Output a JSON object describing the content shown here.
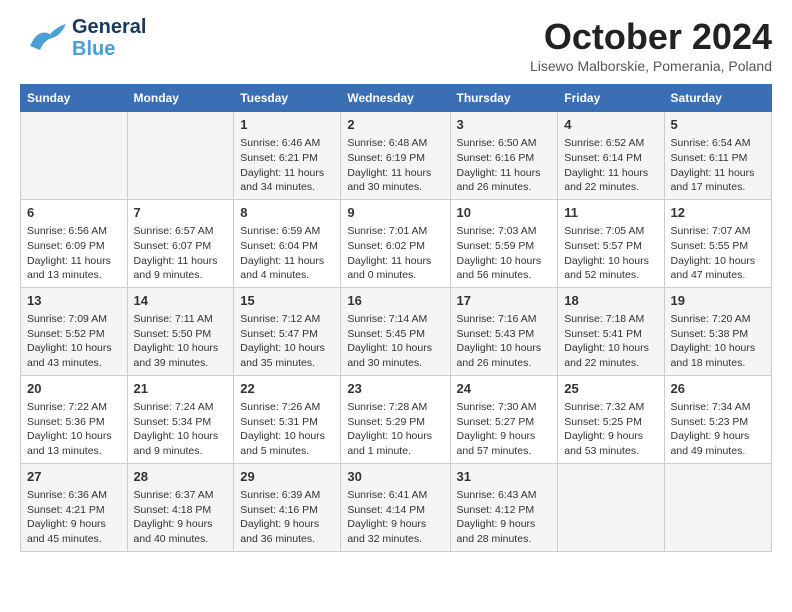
{
  "header": {
    "logo_general": "General",
    "logo_blue": "Blue",
    "month_title": "October 2024",
    "location": "Lisewo Malborskie, Pomerania, Poland"
  },
  "weekdays": [
    "Sunday",
    "Monday",
    "Tuesday",
    "Wednesday",
    "Thursday",
    "Friday",
    "Saturday"
  ],
  "weeks": [
    [
      {
        "day": "",
        "info": ""
      },
      {
        "day": "",
        "info": ""
      },
      {
        "day": "1",
        "info": "Sunrise: 6:46 AM\nSunset: 6:21 PM\nDaylight: 11 hours\nand 34 minutes."
      },
      {
        "day": "2",
        "info": "Sunrise: 6:48 AM\nSunset: 6:19 PM\nDaylight: 11 hours\nand 30 minutes."
      },
      {
        "day": "3",
        "info": "Sunrise: 6:50 AM\nSunset: 6:16 PM\nDaylight: 11 hours\nand 26 minutes."
      },
      {
        "day": "4",
        "info": "Sunrise: 6:52 AM\nSunset: 6:14 PM\nDaylight: 11 hours\nand 22 minutes."
      },
      {
        "day": "5",
        "info": "Sunrise: 6:54 AM\nSunset: 6:11 PM\nDaylight: 11 hours\nand 17 minutes."
      }
    ],
    [
      {
        "day": "6",
        "info": "Sunrise: 6:56 AM\nSunset: 6:09 PM\nDaylight: 11 hours\nand 13 minutes."
      },
      {
        "day": "7",
        "info": "Sunrise: 6:57 AM\nSunset: 6:07 PM\nDaylight: 11 hours\nand 9 minutes."
      },
      {
        "day": "8",
        "info": "Sunrise: 6:59 AM\nSunset: 6:04 PM\nDaylight: 11 hours\nand 4 minutes."
      },
      {
        "day": "9",
        "info": "Sunrise: 7:01 AM\nSunset: 6:02 PM\nDaylight: 11 hours\nand 0 minutes."
      },
      {
        "day": "10",
        "info": "Sunrise: 7:03 AM\nSunset: 5:59 PM\nDaylight: 10 hours\nand 56 minutes."
      },
      {
        "day": "11",
        "info": "Sunrise: 7:05 AM\nSunset: 5:57 PM\nDaylight: 10 hours\nand 52 minutes."
      },
      {
        "day": "12",
        "info": "Sunrise: 7:07 AM\nSunset: 5:55 PM\nDaylight: 10 hours\nand 47 minutes."
      }
    ],
    [
      {
        "day": "13",
        "info": "Sunrise: 7:09 AM\nSunset: 5:52 PM\nDaylight: 10 hours\nand 43 minutes."
      },
      {
        "day": "14",
        "info": "Sunrise: 7:11 AM\nSunset: 5:50 PM\nDaylight: 10 hours\nand 39 minutes."
      },
      {
        "day": "15",
        "info": "Sunrise: 7:12 AM\nSunset: 5:47 PM\nDaylight: 10 hours\nand 35 minutes."
      },
      {
        "day": "16",
        "info": "Sunrise: 7:14 AM\nSunset: 5:45 PM\nDaylight: 10 hours\nand 30 minutes."
      },
      {
        "day": "17",
        "info": "Sunrise: 7:16 AM\nSunset: 5:43 PM\nDaylight: 10 hours\nand 26 minutes."
      },
      {
        "day": "18",
        "info": "Sunrise: 7:18 AM\nSunset: 5:41 PM\nDaylight: 10 hours\nand 22 minutes."
      },
      {
        "day": "19",
        "info": "Sunrise: 7:20 AM\nSunset: 5:38 PM\nDaylight: 10 hours\nand 18 minutes."
      }
    ],
    [
      {
        "day": "20",
        "info": "Sunrise: 7:22 AM\nSunset: 5:36 PM\nDaylight: 10 hours\nand 13 minutes."
      },
      {
        "day": "21",
        "info": "Sunrise: 7:24 AM\nSunset: 5:34 PM\nDaylight: 10 hours\nand 9 minutes."
      },
      {
        "day": "22",
        "info": "Sunrise: 7:26 AM\nSunset: 5:31 PM\nDaylight: 10 hours\nand 5 minutes."
      },
      {
        "day": "23",
        "info": "Sunrise: 7:28 AM\nSunset: 5:29 PM\nDaylight: 10 hours\nand 1 minute."
      },
      {
        "day": "24",
        "info": "Sunrise: 7:30 AM\nSunset: 5:27 PM\nDaylight: 9 hours\nand 57 minutes."
      },
      {
        "day": "25",
        "info": "Sunrise: 7:32 AM\nSunset: 5:25 PM\nDaylight: 9 hours\nand 53 minutes."
      },
      {
        "day": "26",
        "info": "Sunrise: 7:34 AM\nSunset: 5:23 PM\nDaylight: 9 hours\nand 49 minutes."
      }
    ],
    [
      {
        "day": "27",
        "info": "Sunrise: 6:36 AM\nSunset: 4:21 PM\nDaylight: 9 hours\nand 45 minutes."
      },
      {
        "day": "28",
        "info": "Sunrise: 6:37 AM\nSunset: 4:18 PM\nDaylight: 9 hours\nand 40 minutes."
      },
      {
        "day": "29",
        "info": "Sunrise: 6:39 AM\nSunset: 4:16 PM\nDaylight: 9 hours\nand 36 minutes."
      },
      {
        "day": "30",
        "info": "Sunrise: 6:41 AM\nSunset: 4:14 PM\nDaylight: 9 hours\nand 32 minutes."
      },
      {
        "day": "31",
        "info": "Sunrise: 6:43 AM\nSunset: 4:12 PM\nDaylight: 9 hours\nand 28 minutes."
      },
      {
        "day": "",
        "info": ""
      },
      {
        "day": "",
        "info": ""
      }
    ]
  ]
}
